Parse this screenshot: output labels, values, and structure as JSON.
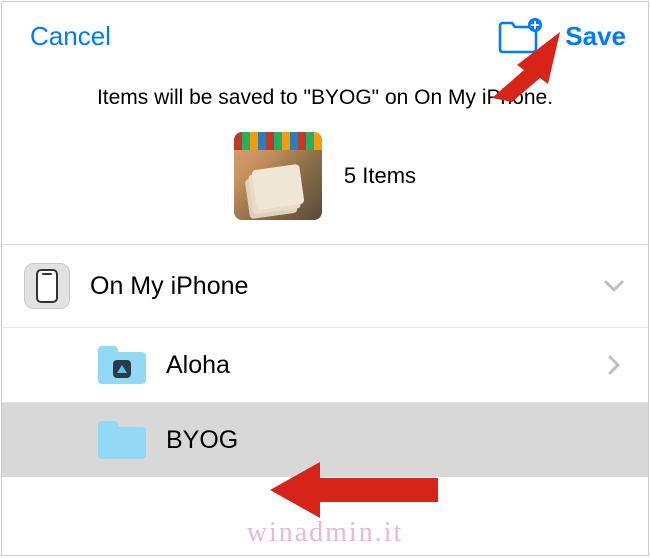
{
  "toolbar": {
    "cancel_label": "Cancel",
    "save_label": "Save"
  },
  "info": {
    "message": "Items will be saved to \"BYOG\" on On My iPhone.",
    "items_count_label": "5 Items"
  },
  "locations": {
    "parent": {
      "label": "On My iPhone"
    },
    "children": [
      {
        "label": "Aloha",
        "selected": false,
        "badge": true
      },
      {
        "label": "BYOG",
        "selected": true,
        "badge": false
      }
    ]
  },
  "watermark": "winadmin.it"
}
